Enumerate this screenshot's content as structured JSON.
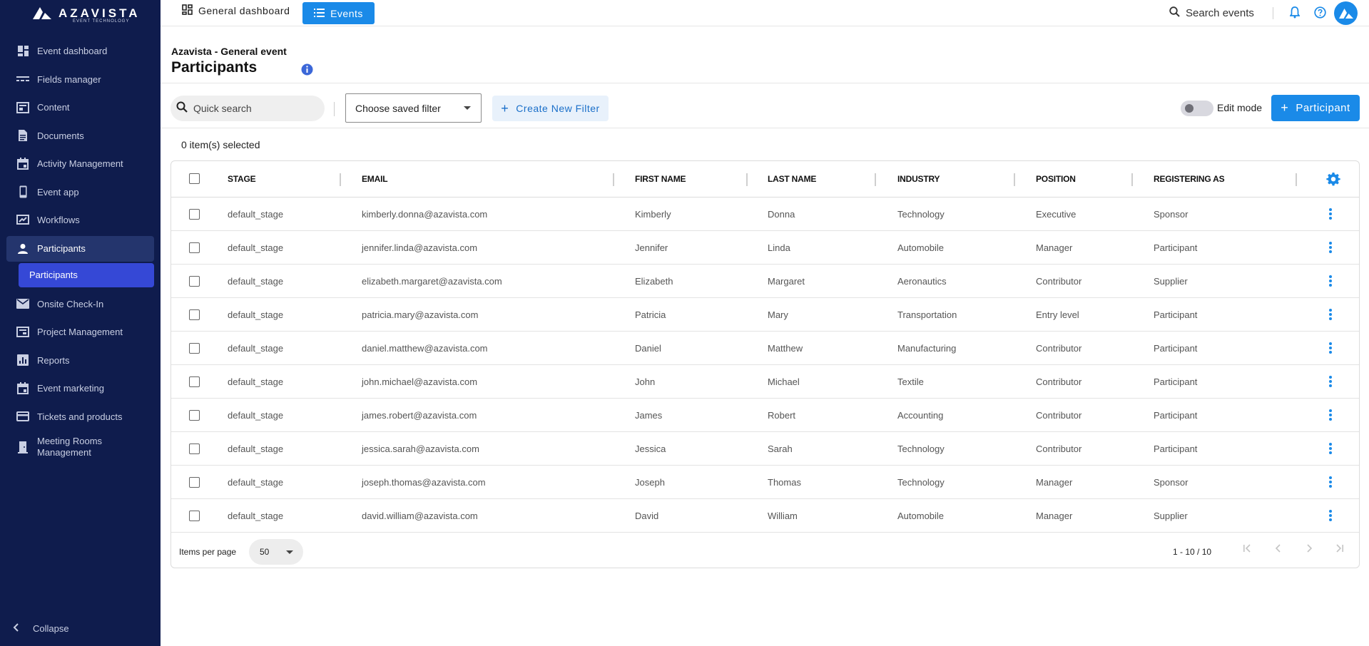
{
  "brand": {
    "name": "AZAVISTA",
    "tagline": "EVENT TECHNOLOGY"
  },
  "topbar": {
    "general_dashboard_label": "General dashboard",
    "events_label": "Events",
    "search_label": "Search events"
  },
  "sidebar": {
    "items": [
      {
        "label": "Event dashboard",
        "icon": "dashboard-icon"
      },
      {
        "label": "Fields manager",
        "icon": "fields-icon"
      },
      {
        "label": "Content",
        "icon": "content-icon"
      },
      {
        "label": "Documents",
        "icon": "document-icon"
      },
      {
        "label": "Activity Management",
        "icon": "calendar-icon"
      },
      {
        "label": "Event app",
        "icon": "phone-icon"
      },
      {
        "label": "Workflows",
        "icon": "workflow-icon"
      },
      {
        "label": "Participants",
        "icon": "person-icon",
        "active": true
      },
      {
        "label": "Onsite Check-In",
        "icon": "mail-icon"
      },
      {
        "label": "Project Management",
        "icon": "project-icon"
      },
      {
        "label": "Reports",
        "icon": "report-icon"
      },
      {
        "label": "Event marketing",
        "icon": "calendar-icon"
      },
      {
        "label": "Tickets and products",
        "icon": "card-icon"
      },
      {
        "label": "Meeting Rooms Management",
        "icon": "room-icon"
      }
    ],
    "sub_item": "Participants",
    "collapse_label": "Collapse"
  },
  "header": {
    "event_name": "Azavista - General event",
    "title": "Participants"
  },
  "toolbar": {
    "search_placeholder": "Quick search",
    "saved_filter_label": "Choose saved filter",
    "create_filter_label": "Create New Filter",
    "edit_mode_label": "Edit mode",
    "add_participant_label": "Participant"
  },
  "selection": {
    "text": "0 item(s) selected"
  },
  "table": {
    "columns": [
      "STAGE",
      "EMAIL",
      "FIRST NAME",
      "LAST NAME",
      "INDUSTRY",
      "POSITION",
      "REGISTERING AS"
    ],
    "rows": [
      [
        "default_stage",
        "kimberly.donna@azavista.com",
        "Kimberly",
        "Donna",
        "Technology",
        "Executive",
        "Sponsor"
      ],
      [
        "default_stage",
        "jennifer.linda@azavista.com",
        "Jennifer",
        "Linda",
        "Automobile",
        "Manager",
        "Participant"
      ],
      [
        "default_stage",
        "elizabeth.margaret@azavista.com",
        "Elizabeth",
        "Margaret",
        "Aeronautics",
        "Contributor",
        "Supplier"
      ],
      [
        "default_stage",
        "patricia.mary@azavista.com",
        "Patricia",
        "Mary",
        "Transportation",
        "Entry level",
        "Participant"
      ],
      [
        "default_stage",
        "daniel.matthew@azavista.com",
        "Daniel",
        "Matthew",
        "Manufacturing",
        "Contributor",
        "Participant"
      ],
      [
        "default_stage",
        "john.michael@azavista.com",
        "John",
        "Michael",
        "Textile",
        "Contributor",
        "Participant"
      ],
      [
        "default_stage",
        "james.robert@azavista.com",
        "James",
        "Robert",
        "Accounting",
        "Contributor",
        "Participant"
      ],
      [
        "default_stage",
        "jessica.sarah@azavista.com",
        "Jessica",
        "Sarah",
        "Technology",
        "Contributor",
        "Participant"
      ],
      [
        "default_stage",
        "joseph.thomas@azavista.com",
        "Joseph",
        "Thomas",
        "Technology",
        "Manager",
        "Sponsor"
      ],
      [
        "default_stage",
        "david.william@azavista.com",
        "David",
        "William",
        "Automobile",
        "Manager",
        "Supplier"
      ]
    ]
  },
  "footer": {
    "items_per_page_label": "Items per page",
    "items_per_page_value": "50",
    "range_text": "1 - 10 / 10"
  },
  "colors": {
    "sidebar_bg": "#0f1c4d",
    "accent": "#1a8ae8",
    "sub_active": "#3548d6"
  }
}
